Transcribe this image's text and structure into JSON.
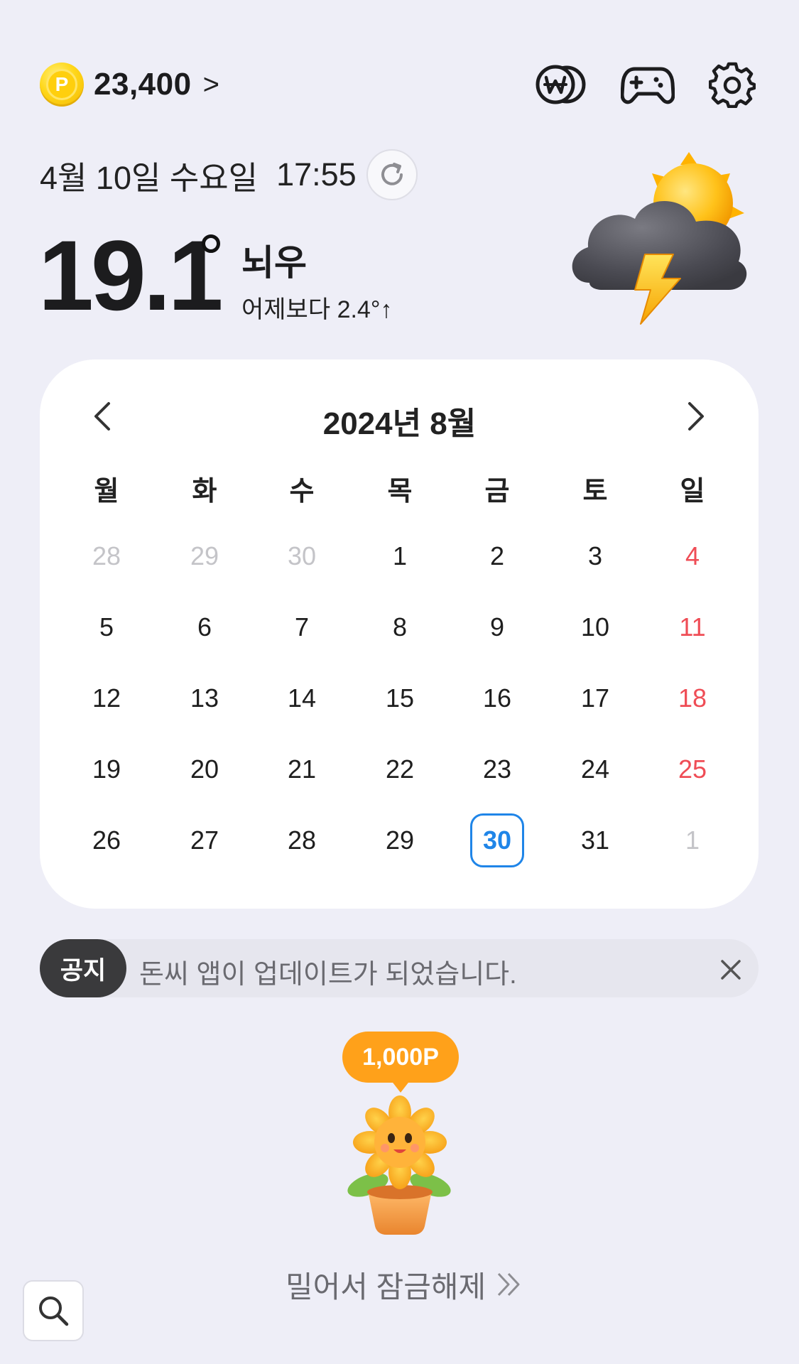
{
  "header": {
    "points_value": "23,400",
    "points_chevron": ">",
    "coin_letter": "P",
    "icons": [
      "won-coins-icon",
      "gamepad-icon",
      "settings-gear-icon"
    ]
  },
  "weather": {
    "date": "4월 10일 수요일",
    "time": "17:55",
    "temperature": "19.1",
    "condition": "뇌우",
    "comparison": "어제보다 2.4°↑",
    "icon": "thunderstorm-sun-cloud-icon"
  },
  "calendar": {
    "title": "2024년 8월",
    "weekdays": [
      "월",
      "화",
      "수",
      "목",
      "금",
      "토",
      "일"
    ],
    "weeks": [
      [
        "28",
        "29",
        "30",
        "1",
        "2",
        "3",
        "4"
      ],
      [
        "5",
        "6",
        "7",
        "8",
        "9",
        "10",
        "11"
      ],
      [
        "12",
        "13",
        "14",
        "15",
        "16",
        "17",
        "18"
      ],
      [
        "19",
        "20",
        "21",
        "22",
        "23",
        "24",
        "25"
      ],
      [
        "26",
        "27",
        "28",
        "29",
        "30",
        "31",
        "1"
      ]
    ],
    "today": "30",
    "colors": {
      "today": "#1f85e8",
      "sunday": "#ef4d56",
      "muted": "#c4c4c8"
    }
  },
  "notice": {
    "badge": "공지",
    "text": "돈씨 앱이 업데이트가 되었습니다."
  },
  "reward": {
    "bubble": "1,000P",
    "unlock_label": "밀어서 잠금해제",
    "mascot": "sunflower-pot-icon"
  }
}
